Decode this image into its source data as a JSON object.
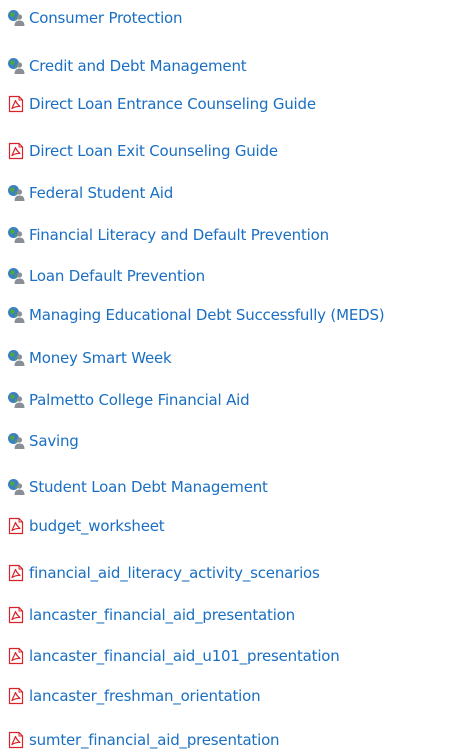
{
  "links": [
    {
      "icon": "web-link-icon",
      "label": "Consumer Protection"
    },
    {
      "icon": "web-link-icon",
      "label": "Credit and Debt Management"
    },
    {
      "icon": "pdf-file-icon",
      "label": "Direct Loan Entrance Counseling Guide"
    },
    {
      "icon": "pdf-file-icon",
      "label": "Direct Loan Exit Counseling Guide"
    },
    {
      "icon": "web-link-icon",
      "label": "Federal Student Aid"
    },
    {
      "icon": "web-link-icon",
      "label": "Financial Literacy and Default Prevention"
    },
    {
      "icon": "web-link-icon",
      "label": "Loan Default Prevention"
    },
    {
      "icon": "web-link-icon",
      "label": "Managing Educational Debt Successfully (MEDS)"
    },
    {
      "icon": "web-link-icon",
      "label": "Money Smart Week"
    },
    {
      "icon": "web-link-icon",
      "label": "Palmetto College Financial Aid"
    },
    {
      "icon": "web-link-icon",
      "label": "Saving"
    },
    {
      "icon": "web-link-icon",
      "label": "Student Loan Debt Management"
    },
    {
      "icon": "pdf-file-icon",
      "label": "budget_worksheet"
    },
    {
      "icon": "pdf-file-icon",
      "label": "financial_aid_literacy_activity_scenarios"
    },
    {
      "icon": "pdf-file-icon",
      "label": "lancaster_financial_aid_presentation"
    },
    {
      "icon": "pdf-file-icon",
      "label": "lancaster_financial_aid_u101_presentation"
    },
    {
      "icon": "pdf-file-icon",
      "label": "lancaster_freshman_orientation"
    },
    {
      "icon": "pdf-file-icon",
      "label": "sumter_financial_aid_presentation"
    }
  ],
  "colors": {
    "link": "#1a6fc2",
    "pdf_red": "#d8232a",
    "globe_blue": "#3d7fc4",
    "globe_green": "#4fa83a",
    "person_gray": "#8a8f96"
  }
}
